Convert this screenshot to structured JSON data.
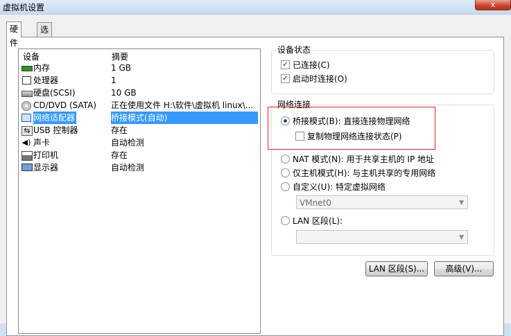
{
  "window": {
    "title": "虚拟机设置",
    "close_label": "x"
  },
  "tabs": [
    {
      "label": "硬件"
    },
    {
      "label": "选项"
    }
  ],
  "device_list": {
    "col_device": "设备",
    "col_summary": "摘要",
    "rows": [
      {
        "icon": "memory-icon",
        "name": "内存",
        "summary": "1 GB"
      },
      {
        "icon": "cpu-icon",
        "name": "处理器",
        "summary": "1"
      },
      {
        "icon": "harddisk-icon",
        "name": "硬盘(SCSI)",
        "summary": "10 GB"
      },
      {
        "icon": "cdrom-icon",
        "name": "CD/DVD (SATA)",
        "summary": "正在使用文件 H:\\软件\\虚拟机 linux\\..."
      },
      {
        "icon": "network-adapter-icon",
        "name": "网络适配器",
        "summary": "桥接模式(自动)",
        "selected": true
      },
      {
        "icon": "usb-icon",
        "name": "USB 控制器",
        "summary": "存在"
      },
      {
        "icon": "sound-icon",
        "name": "声卡",
        "summary": "自动检测"
      },
      {
        "icon": "printer-icon",
        "name": "打印机",
        "summary": "存在"
      },
      {
        "icon": "display-icon",
        "name": "显示器",
        "summary": "自动检测"
      }
    ]
  },
  "device_status": {
    "title": "设备状态",
    "connected": {
      "label": "已连接(C)",
      "checked": true
    },
    "connect_on_power": {
      "label": "启动时连接(O)",
      "checked": true
    }
  },
  "network": {
    "title": "网络连接",
    "bridged": {
      "label": "桥接模式(B): 直接连接物理网络",
      "selected": true
    },
    "replicate": {
      "label": "复制物理网络连接状态(P)",
      "checked": false
    },
    "nat": {
      "label": "NAT 模式(N): 用于共享主机的 IP 地址",
      "selected": false
    },
    "hostonly": {
      "label": "仅主机模式(H): 与主机共享的专用网络",
      "selected": false
    },
    "custom": {
      "label": "自定义(U): 特定虚拟网络",
      "selected": false
    },
    "vmnet_value": "VMnet0",
    "lan_segment": {
      "label": "LAN 区段(L):",
      "selected": false
    },
    "lan_value": ""
  },
  "buttons": {
    "lan_segments": "LAN 区段(S)...",
    "advanced": "高级(V)..."
  },
  "colors": {
    "selection": "#3399ff",
    "highlight_box": "#e0202a"
  }
}
